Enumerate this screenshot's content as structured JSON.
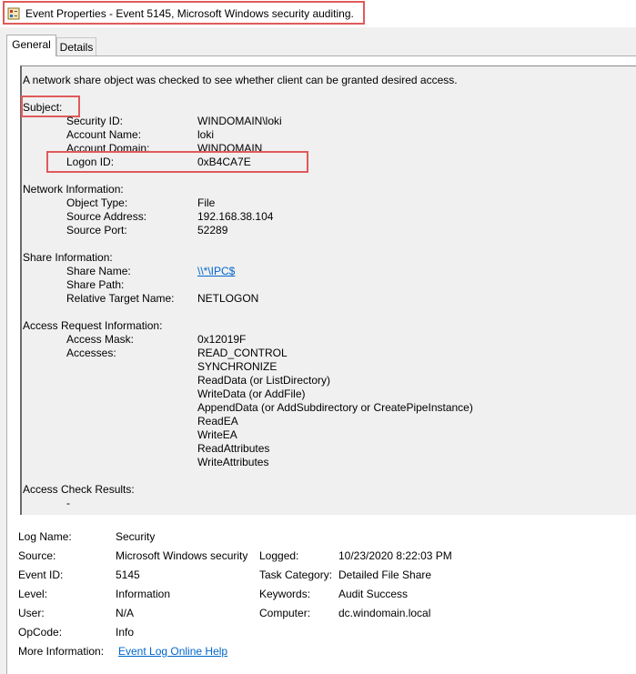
{
  "window": {
    "title": "Event Properties - Event 5145, Microsoft Windows security auditing."
  },
  "tabs": [
    "General",
    "Details"
  ],
  "description": {
    "intro": "A network share object was checked to see whether client can be granted desired access.",
    "subject": {
      "heading": "Subject:",
      "rows": [
        {
          "label": "Security ID:",
          "value": "WINDOMAIN\\loki"
        },
        {
          "label": "Account Name:",
          "value": "loki"
        },
        {
          "label": "Account Domain:",
          "value": "WINDOMAIN"
        },
        {
          "label": "Logon ID:",
          "value": "0xB4CA7E"
        }
      ]
    },
    "network": {
      "heading": "Network Information:",
      "rows": [
        {
          "label": "Object Type:",
          "value": "File"
        },
        {
          "label": "Source Address:",
          "value": "192.168.38.104"
        },
        {
          "label": "Source Port:",
          "value": "52289"
        }
      ]
    },
    "share": {
      "heading": "Share Information:",
      "rows": [
        {
          "label": "Share Name:",
          "value": "\\\\*\\IPC$"
        },
        {
          "label": "Share Path:",
          "value": ""
        },
        {
          "label": "Relative Target Name:",
          "value": "NETLOGON"
        }
      ]
    },
    "access": {
      "heading": "Access Request Information:",
      "mask_label": "Access Mask:",
      "mask_value": "0x12019F",
      "accesses_label": "Accesses:",
      "accesses": [
        "READ_CONTROL",
        "SYNCHRONIZE",
        "ReadData (or ListDirectory)",
        "WriteData (or AddFile)",
        "AppendData (or AddSubdirectory or CreatePipeInstance)",
        "ReadEA",
        "WriteEA",
        "ReadAttributes",
        "WriteAttributes"
      ]
    },
    "check": {
      "heading": "Access Check Results:",
      "value": "-"
    }
  },
  "details": {
    "log_name_label": "Log Name:",
    "log_name": "Security",
    "source_label": "Source:",
    "source": "Microsoft Windows security",
    "logged_label": "Logged:",
    "logged": "10/23/2020 8:22:03 PM",
    "event_id_label": "Event ID:",
    "event_id": "5145",
    "task_category_label": "Task Category:",
    "task_category": "Detailed File Share",
    "level_label": "Level:",
    "level": "Information",
    "keywords_label": "Keywords:",
    "keywords": "Audit Success",
    "user_label": "User:",
    "user": "N/A",
    "computer_label": "Computer:",
    "computer": "dc.windomain.local",
    "opcode_label": "OpCode:",
    "opcode": "Info",
    "more_info_label": "More Information:",
    "more_info_link": "Event Log Online Help"
  },
  "colors": {
    "highlight": "#e05a5a",
    "link": "#0066cc"
  },
  "icons": {
    "app": "event-viewer-icon"
  }
}
